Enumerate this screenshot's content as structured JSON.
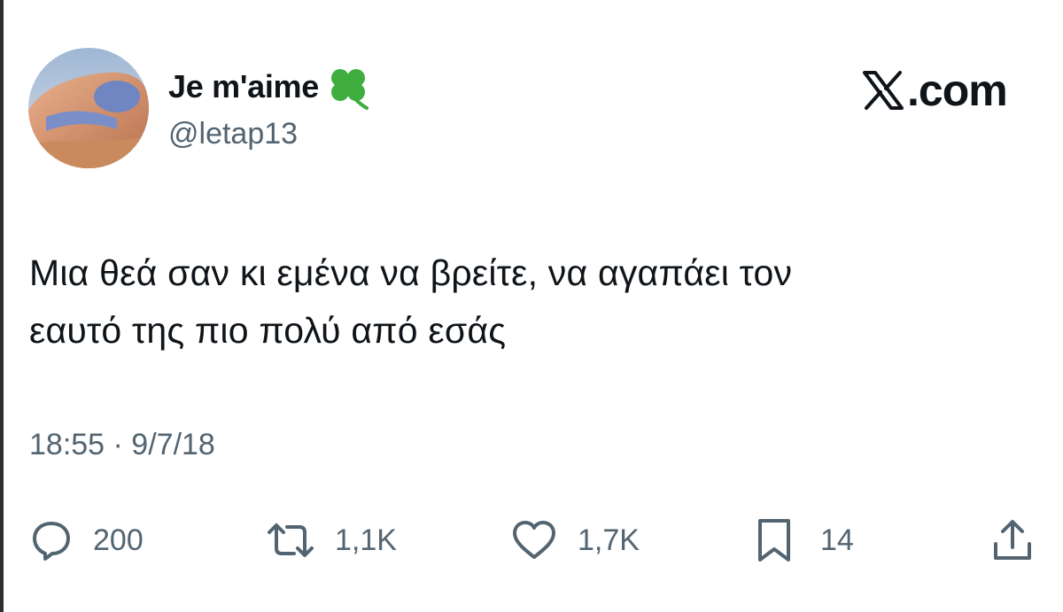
{
  "tweet": {
    "display_name": "Je m'aime",
    "name_emoji_icon": "shamrock-icon",
    "handle": "@letap13",
    "brand": ".com",
    "brand_icon": "x-logo-icon",
    "text_line1": "Μια θεά σαν κι εμένα να βρείτε, να αγαπάει τον",
    "text_line2": "εαυτό της πιο πολύ από εσάς",
    "timestamp": "18:55 · 9/7/18"
  },
  "actions": {
    "replies": "200",
    "reposts": "1,1K",
    "likes": "1,7K",
    "bookmarks": "14"
  },
  "colors": {
    "text": "#0f1419",
    "secondary": "#536471",
    "clover": "#3fae3f"
  }
}
